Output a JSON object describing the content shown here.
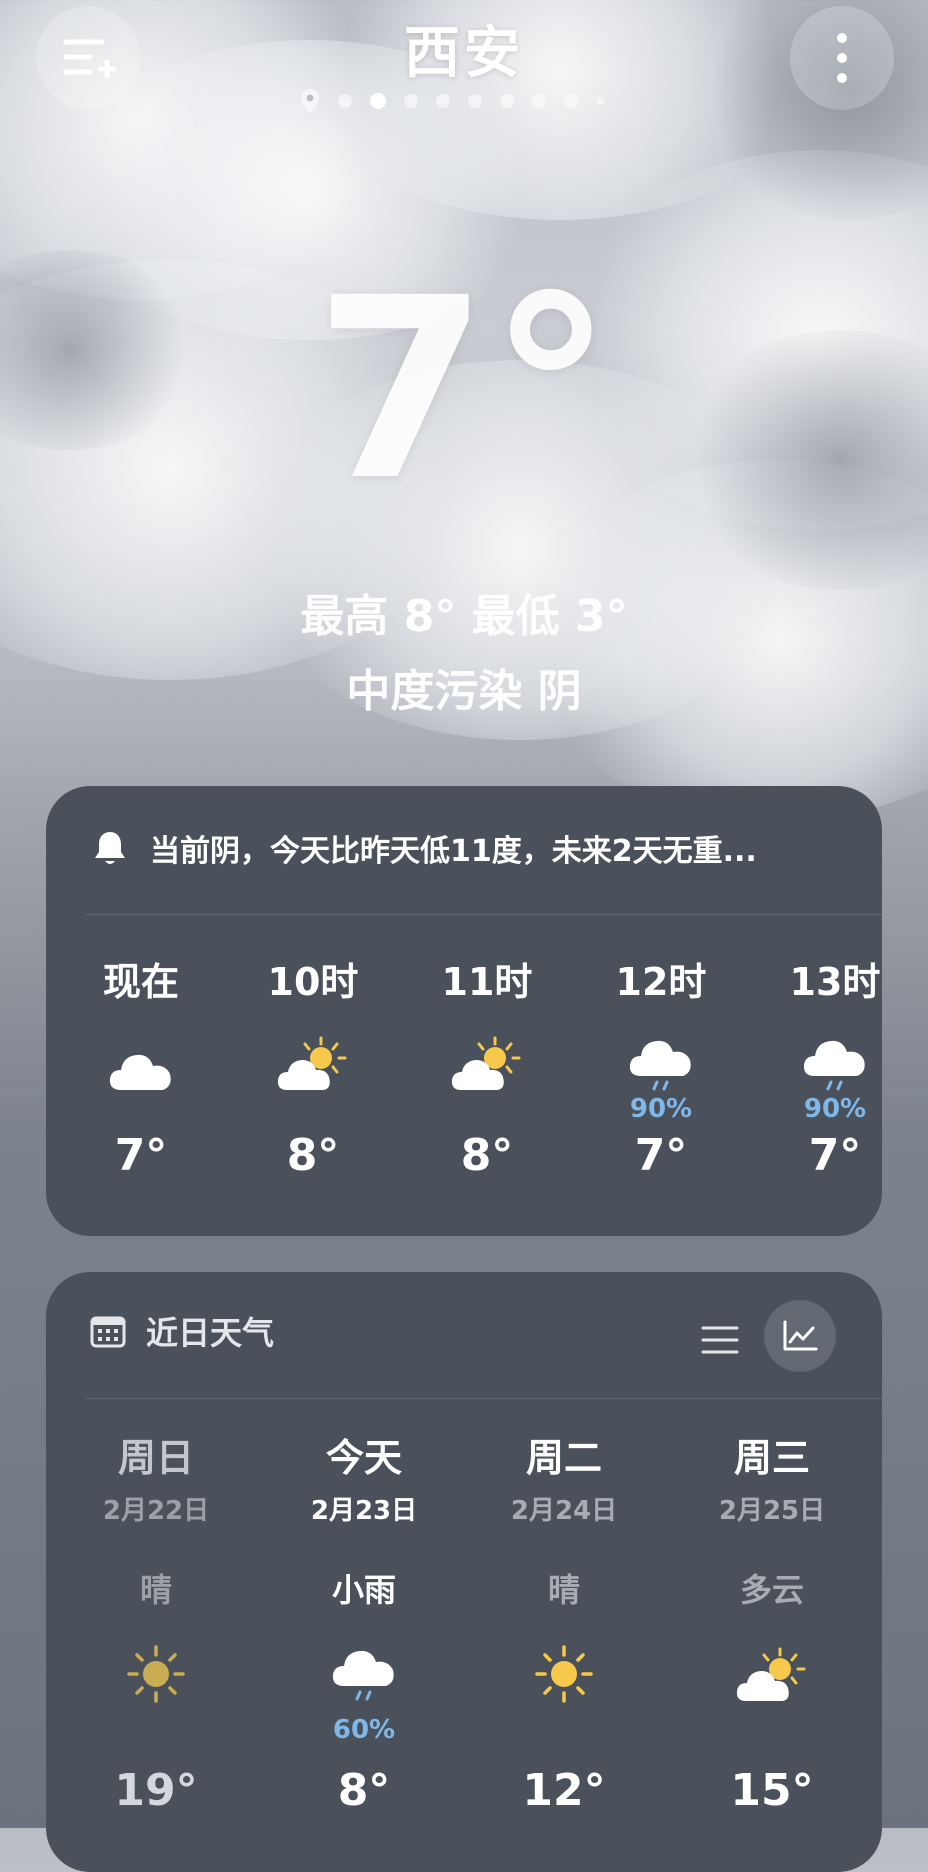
{
  "header": {
    "city": "西安",
    "page_indicator": {
      "total": 10,
      "active_index": 2
    }
  },
  "current": {
    "temperature": "7°",
    "high_low": "最高 8° 最低 3°",
    "condition_line": "中度污染  阴"
  },
  "alert": {
    "text": "当前阴，今天比昨天低11度，未来2天无重..."
  },
  "hourly": [
    {
      "label": "现在",
      "icon": "cloud-icon",
      "precip": "",
      "temp": "7°"
    },
    {
      "label": "10时",
      "icon": "partly-sunny-icon",
      "precip": "",
      "temp": "8°"
    },
    {
      "label": "11时",
      "icon": "partly-sunny-icon",
      "precip": "",
      "temp": "8°"
    },
    {
      "label": "12时",
      "icon": "rain-cloud-icon",
      "precip": "90%",
      "temp": "7°"
    },
    {
      "label": "13时",
      "icon": "rain-cloud-icon",
      "precip": "90%",
      "temp": "7°"
    }
  ],
  "daily": {
    "title": "近日天气",
    "days": [
      {
        "name": "周日",
        "date": "2月22日",
        "weather": "晴",
        "icon": "sun-icon",
        "precip": "",
        "temp": "19°"
      },
      {
        "name": "今天",
        "date": "2月23日",
        "weather": "小雨",
        "icon": "rain-cloud-icon",
        "precip": "60%",
        "temp": "8°"
      },
      {
        "name": "周二",
        "date": "2月24日",
        "weather": "晴",
        "icon": "sun-icon",
        "precip": "",
        "temp": "12°"
      },
      {
        "name": "周三",
        "date": "2月25日",
        "weather": "多云",
        "icon": "partly-sunny-icon",
        "precip": "",
        "temp": "15°"
      }
    ]
  },
  "colors": {
    "card_bg": "#4a515b",
    "precip_blue": "#7fb7e8",
    "sun_yellow": "#f6c94d"
  }
}
